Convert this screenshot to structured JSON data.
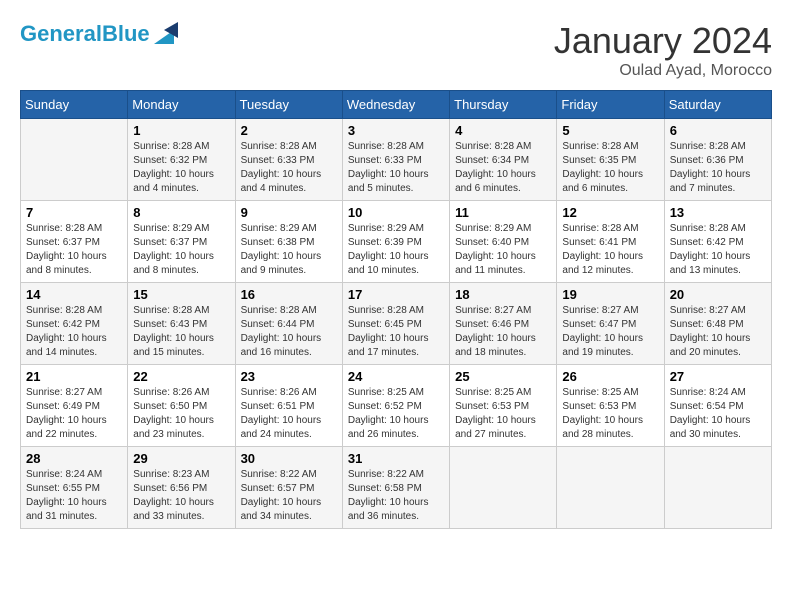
{
  "header": {
    "logo_line1": "General",
    "logo_line2": "Blue",
    "month": "January 2024",
    "location": "Oulad Ayad, Morocco"
  },
  "days_of_week": [
    "Sunday",
    "Monday",
    "Tuesday",
    "Wednesday",
    "Thursday",
    "Friday",
    "Saturday"
  ],
  "weeks": [
    [
      {
        "day": "",
        "info": ""
      },
      {
        "day": "1",
        "info": "Sunrise: 8:28 AM\nSunset: 6:32 PM\nDaylight: 10 hours\nand 4 minutes."
      },
      {
        "day": "2",
        "info": "Sunrise: 8:28 AM\nSunset: 6:33 PM\nDaylight: 10 hours\nand 4 minutes."
      },
      {
        "day": "3",
        "info": "Sunrise: 8:28 AM\nSunset: 6:33 PM\nDaylight: 10 hours\nand 5 minutes."
      },
      {
        "day": "4",
        "info": "Sunrise: 8:28 AM\nSunset: 6:34 PM\nDaylight: 10 hours\nand 6 minutes."
      },
      {
        "day": "5",
        "info": "Sunrise: 8:28 AM\nSunset: 6:35 PM\nDaylight: 10 hours\nand 6 minutes."
      },
      {
        "day": "6",
        "info": "Sunrise: 8:28 AM\nSunset: 6:36 PM\nDaylight: 10 hours\nand 7 minutes."
      }
    ],
    [
      {
        "day": "7",
        "info": "Sunrise: 8:28 AM\nSunset: 6:37 PM\nDaylight: 10 hours\nand 8 minutes."
      },
      {
        "day": "8",
        "info": "Sunrise: 8:29 AM\nSunset: 6:37 PM\nDaylight: 10 hours\nand 8 minutes."
      },
      {
        "day": "9",
        "info": "Sunrise: 8:29 AM\nSunset: 6:38 PM\nDaylight: 10 hours\nand 9 minutes."
      },
      {
        "day": "10",
        "info": "Sunrise: 8:29 AM\nSunset: 6:39 PM\nDaylight: 10 hours\nand 10 minutes."
      },
      {
        "day": "11",
        "info": "Sunrise: 8:29 AM\nSunset: 6:40 PM\nDaylight: 10 hours\nand 11 minutes."
      },
      {
        "day": "12",
        "info": "Sunrise: 8:28 AM\nSunset: 6:41 PM\nDaylight: 10 hours\nand 12 minutes."
      },
      {
        "day": "13",
        "info": "Sunrise: 8:28 AM\nSunset: 6:42 PM\nDaylight: 10 hours\nand 13 minutes."
      }
    ],
    [
      {
        "day": "14",
        "info": "Sunrise: 8:28 AM\nSunset: 6:42 PM\nDaylight: 10 hours\nand 14 minutes."
      },
      {
        "day": "15",
        "info": "Sunrise: 8:28 AM\nSunset: 6:43 PM\nDaylight: 10 hours\nand 15 minutes."
      },
      {
        "day": "16",
        "info": "Sunrise: 8:28 AM\nSunset: 6:44 PM\nDaylight: 10 hours\nand 16 minutes."
      },
      {
        "day": "17",
        "info": "Sunrise: 8:28 AM\nSunset: 6:45 PM\nDaylight: 10 hours\nand 17 minutes."
      },
      {
        "day": "18",
        "info": "Sunrise: 8:27 AM\nSunset: 6:46 PM\nDaylight: 10 hours\nand 18 minutes."
      },
      {
        "day": "19",
        "info": "Sunrise: 8:27 AM\nSunset: 6:47 PM\nDaylight: 10 hours\nand 19 minutes."
      },
      {
        "day": "20",
        "info": "Sunrise: 8:27 AM\nSunset: 6:48 PM\nDaylight: 10 hours\nand 20 minutes."
      }
    ],
    [
      {
        "day": "21",
        "info": "Sunrise: 8:27 AM\nSunset: 6:49 PM\nDaylight: 10 hours\nand 22 minutes."
      },
      {
        "day": "22",
        "info": "Sunrise: 8:26 AM\nSunset: 6:50 PM\nDaylight: 10 hours\nand 23 minutes."
      },
      {
        "day": "23",
        "info": "Sunrise: 8:26 AM\nSunset: 6:51 PM\nDaylight: 10 hours\nand 24 minutes."
      },
      {
        "day": "24",
        "info": "Sunrise: 8:25 AM\nSunset: 6:52 PM\nDaylight: 10 hours\nand 26 minutes."
      },
      {
        "day": "25",
        "info": "Sunrise: 8:25 AM\nSunset: 6:53 PM\nDaylight: 10 hours\nand 27 minutes."
      },
      {
        "day": "26",
        "info": "Sunrise: 8:25 AM\nSunset: 6:53 PM\nDaylight: 10 hours\nand 28 minutes."
      },
      {
        "day": "27",
        "info": "Sunrise: 8:24 AM\nSunset: 6:54 PM\nDaylight: 10 hours\nand 30 minutes."
      }
    ],
    [
      {
        "day": "28",
        "info": "Sunrise: 8:24 AM\nSunset: 6:55 PM\nDaylight: 10 hours\nand 31 minutes."
      },
      {
        "day": "29",
        "info": "Sunrise: 8:23 AM\nSunset: 6:56 PM\nDaylight: 10 hours\nand 33 minutes."
      },
      {
        "day": "30",
        "info": "Sunrise: 8:22 AM\nSunset: 6:57 PM\nDaylight: 10 hours\nand 34 minutes."
      },
      {
        "day": "31",
        "info": "Sunrise: 8:22 AM\nSunset: 6:58 PM\nDaylight: 10 hours\nand 36 minutes."
      },
      {
        "day": "",
        "info": ""
      },
      {
        "day": "",
        "info": ""
      },
      {
        "day": "",
        "info": ""
      }
    ]
  ]
}
